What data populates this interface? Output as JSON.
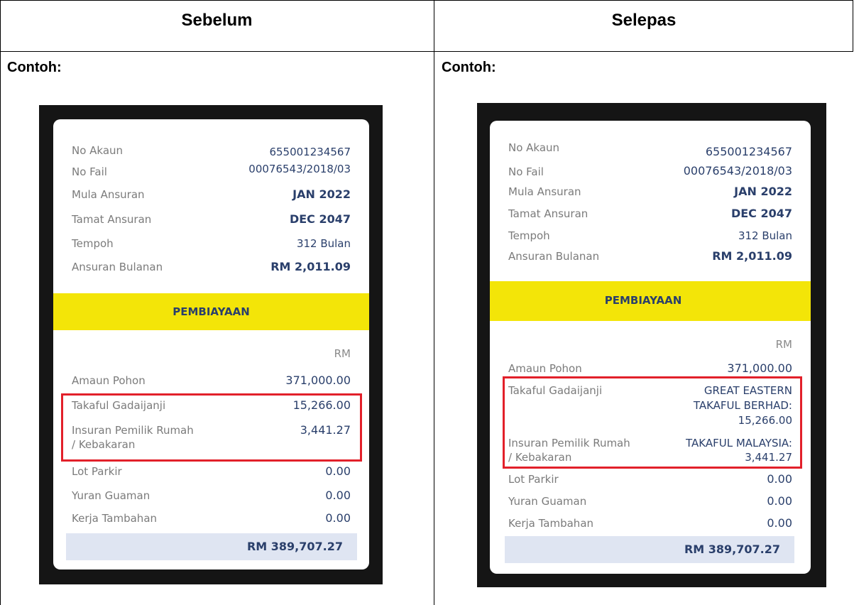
{
  "table": {
    "col_left_header": "Sebelum",
    "col_right_header": "Selepas",
    "example_label": "Contoh:"
  },
  "before": {
    "rows": [
      {
        "label": "No Akaun",
        "value": "655001234567"
      },
      {
        "label": "No Fail",
        "value": "00076543/2018/03"
      },
      {
        "label": "Mula Ansuran",
        "value": "JAN 2022"
      },
      {
        "label": "Tamat Ansuran",
        "value": "DEC 2047"
      },
      {
        "label": "Tempoh",
        "value": "312 Bulan"
      },
      {
        "label": "Ansuran Bulanan",
        "value": "RM 2,011.09"
      }
    ],
    "section_title": "PEMBIAYAAN",
    "currency": "RM",
    "amount_rows": [
      {
        "label": "Amaun Pohon",
        "value": "371,000.00"
      },
      {
        "label": "Takaful Gadaijanji",
        "value": "15,266.00"
      },
      {
        "label_line1": "Insuran Pemilik Rumah",
        "label_line2": "/ Kebakaran",
        "value": "3,441.27"
      },
      {
        "label": "Lot Parkir",
        "value": "0.00"
      },
      {
        "label": "Yuran Guaman",
        "value": "0.00"
      },
      {
        "label": "Kerja Tambahan",
        "value": "0.00"
      }
    ],
    "total": "RM 389,707.27"
  },
  "after": {
    "rows": [
      {
        "label": "No Akaun",
        "value": "655001234567"
      },
      {
        "label": "No Fail",
        "value": "00076543/2018/03"
      },
      {
        "label": "Mula Ansuran",
        "value": "JAN 2022"
      },
      {
        "label": "Tamat Ansuran",
        "value": "DEC 2047"
      },
      {
        "label": "Tempoh",
        "value": "312 Bulan"
      },
      {
        "label": "Ansuran Bulanan",
        "value": "RM 2,011.09"
      }
    ],
    "section_title": "PEMBIAYAAN",
    "currency": "RM",
    "amount_rows": [
      {
        "label": "Amaun Pohon",
        "value": "371,000.00"
      },
      {
        "label": "Takaful Gadaijanji",
        "value_line1": "GREAT EASTERN",
        "value_line2": "TAKAFUL BERHAD:",
        "value_line3": "15,266.00"
      },
      {
        "label_line1": "Insuran Pemilik Rumah",
        "label_line2": "/ Kebakaran",
        "value_line1": "TAKAFUL MALAYSIA:",
        "value_line2": "3,441.27"
      },
      {
        "label": "Lot Parkir",
        "value": "0.00"
      },
      {
        "label": "Yuran Guaman",
        "value": "0.00"
      },
      {
        "label": "Kerja Tambahan",
        "value": "0.00"
      }
    ],
    "total": "RM 389,707.27"
  },
  "colors": {
    "band": "#f3e508",
    "value_text": "#2a3f6b",
    "highlight": "#e2202a",
    "total_bg": "#dfe5f2"
  }
}
